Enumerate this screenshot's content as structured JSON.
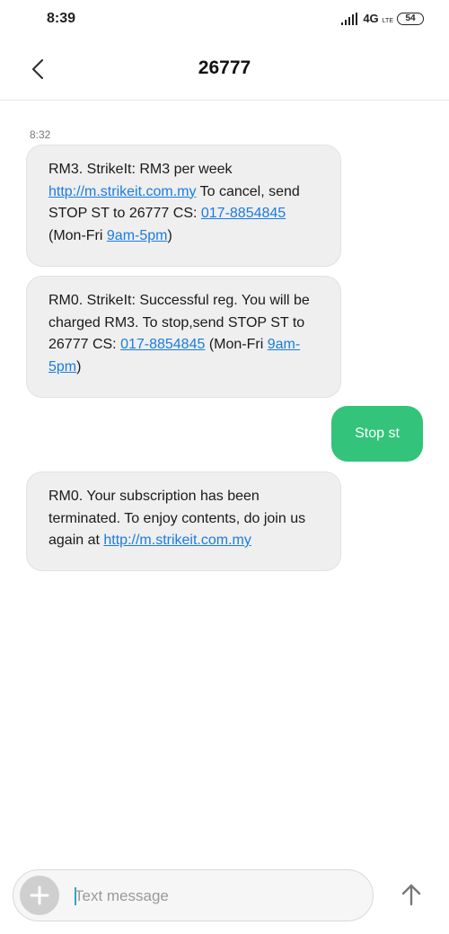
{
  "status_bar": {
    "time": "8:39",
    "network": "4G",
    "network_sub": "LTE",
    "battery": "54"
  },
  "header": {
    "title": "26777"
  },
  "conversation": {
    "timestamp": "8:32",
    "messages": [
      {
        "direction": "incoming",
        "parts": [
          {
            "text": "RM3. StrikeIt: RM3 per week ",
            "link": false
          },
          {
            "text": "http://m",
            "link": true
          },
          {
            "text": ".strikeit.com.my",
            "link": true
          },
          {
            "text": " To cancel, send STOP ST to 26777 CS: ",
            "link": false
          },
          {
            "text": "017-8854845",
            "link": true
          },
          {
            "text": " (Mon-Fri ",
            "link": false
          },
          {
            "text": "9am-5pm",
            "link": true
          },
          {
            "text": ")",
            "link": false
          }
        ]
      },
      {
        "direction": "incoming",
        "parts": [
          {
            "text": "RM0. StrikeIt: Successful reg. You will be charged RM3. To stop,send STOP ST to 26777 CS: ",
            "link": false
          },
          {
            "text": "017-8854845",
            "link": true
          },
          {
            "text": " (Mon-Fri ",
            "link": false
          },
          {
            "text": "9am-5pm",
            "link": true
          },
          {
            "text": ")",
            "link": false
          }
        ]
      },
      {
        "direction": "outgoing",
        "text": "Stop st"
      },
      {
        "direction": "incoming",
        "parts": [
          {
            "text": "RM0. Your subscription has been terminated. To enjoy contents, do join us again at ",
            "link": false
          },
          {
            "text": "http://m.strikeit.com.my",
            "link": true
          }
        ]
      }
    ]
  },
  "composer": {
    "placeholder": "Text message",
    "value": ""
  },
  "colors": {
    "outgoing_bubble": "#33c37a",
    "incoming_bubble": "#efefef",
    "link": "#1a7ce0"
  },
  "icons": {
    "back": "chevron-left-icon",
    "add": "plus-icon",
    "send": "arrow-up-icon",
    "signal": "signal-icon",
    "battery": "battery-icon"
  }
}
